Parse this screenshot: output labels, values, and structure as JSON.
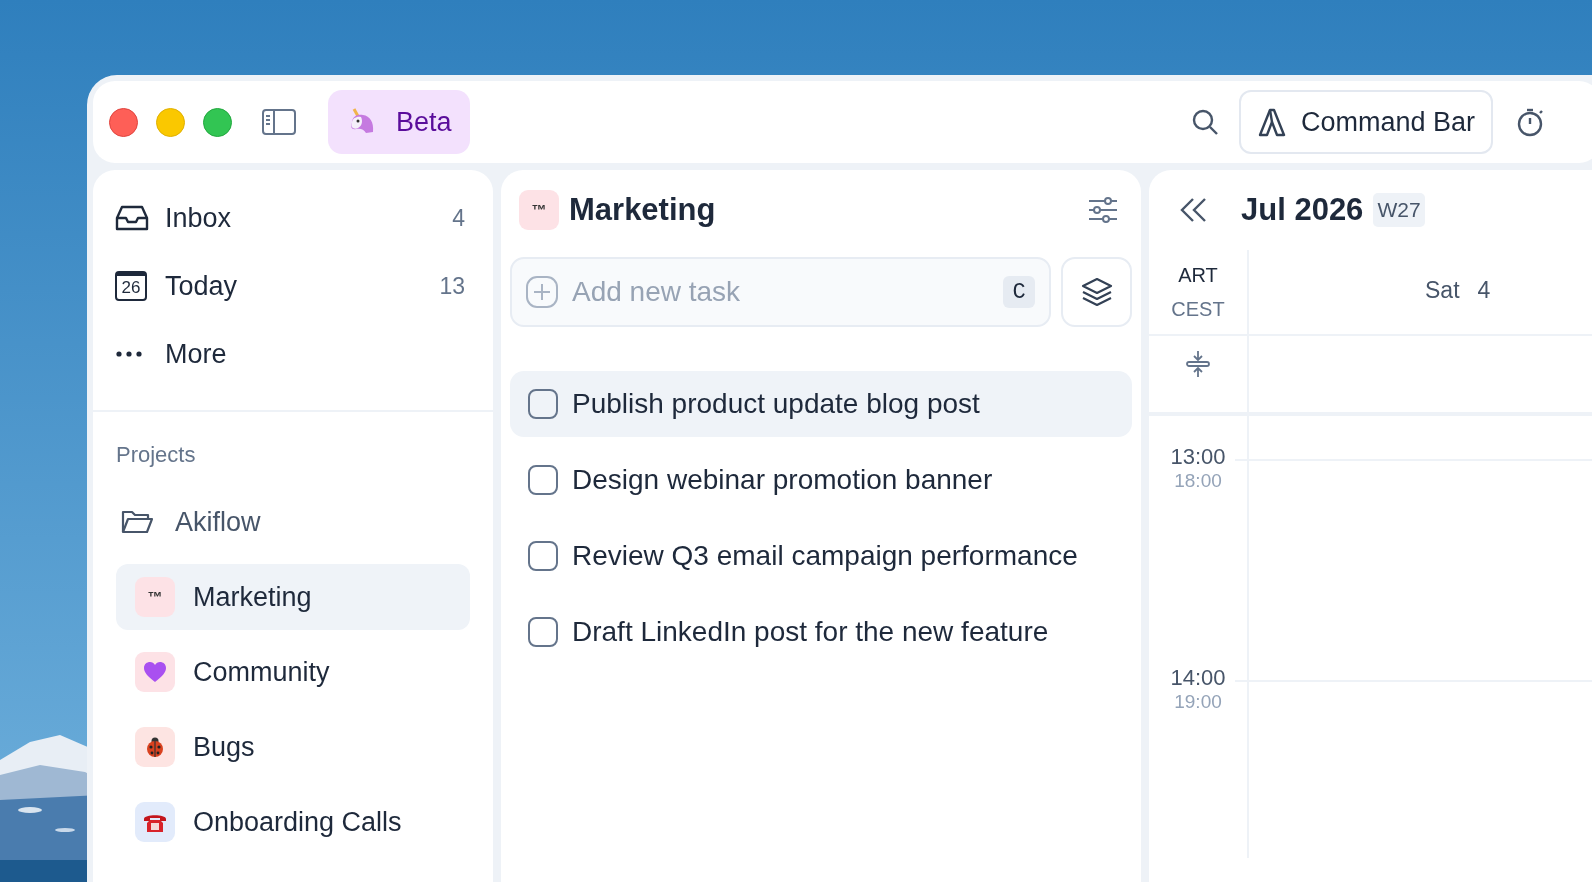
{
  "title_bar": {
    "beta_button": {
      "label": "Beta"
    },
    "command_bar": {
      "label": "Command Bar"
    }
  },
  "sidebar": {
    "nav": [
      {
        "label": "Inbox",
        "count": "4",
        "kind": "inbox"
      },
      {
        "label": "Today",
        "count": "13",
        "kind": "calendar",
        "icon_text": "26"
      },
      {
        "label": "More",
        "kind": "more"
      }
    ],
    "projects_heading": "Projects",
    "projects": [
      {
        "name": "Akiflow",
        "kind": "folder",
        "selected": false,
        "children": [
          {
            "name": "Marketing",
            "kind": "text",
            "icon_text": "™",
            "color": "#fde2e6",
            "selected": true
          },
          {
            "name": "Community",
            "kind": "heart",
            "color": "#fde2e6",
            "selected": false
          },
          {
            "name": "Bugs",
            "kind": "ladybug",
            "color": "#fde4e2",
            "selected": false
          },
          {
            "name": "Onboarding Calls",
            "kind": "telephone",
            "color": "#e2ebfb",
            "selected": false
          }
        ]
      }
    ]
  },
  "task_list": {
    "title": "Marketing",
    "icon_text": "™",
    "add_task": {
      "placeholder": "Add new task",
      "shortcut": "C"
    },
    "tasks": [
      {
        "title": "Publish product update blog post",
        "checked": false,
        "selected": true
      },
      {
        "title": "Design webinar promotion banner",
        "checked": false,
        "selected": false
      },
      {
        "title": "Review Q3 email campaign performance",
        "checked": false,
        "selected": false
      },
      {
        "title": "Draft LinkedIn post for the new feature",
        "checked": false,
        "selected": false
      }
    ]
  },
  "calendar": {
    "month": "Jul 2026",
    "week": "W27",
    "timezones": [
      "ART",
      "CEST"
    ],
    "day": {
      "name": "Sat",
      "number": "4"
    },
    "hours": [
      {
        "primary": "13:00",
        "secondary": "18:00"
      },
      {
        "primary": "14:00",
        "secondary": "19:00"
      }
    ]
  }
}
